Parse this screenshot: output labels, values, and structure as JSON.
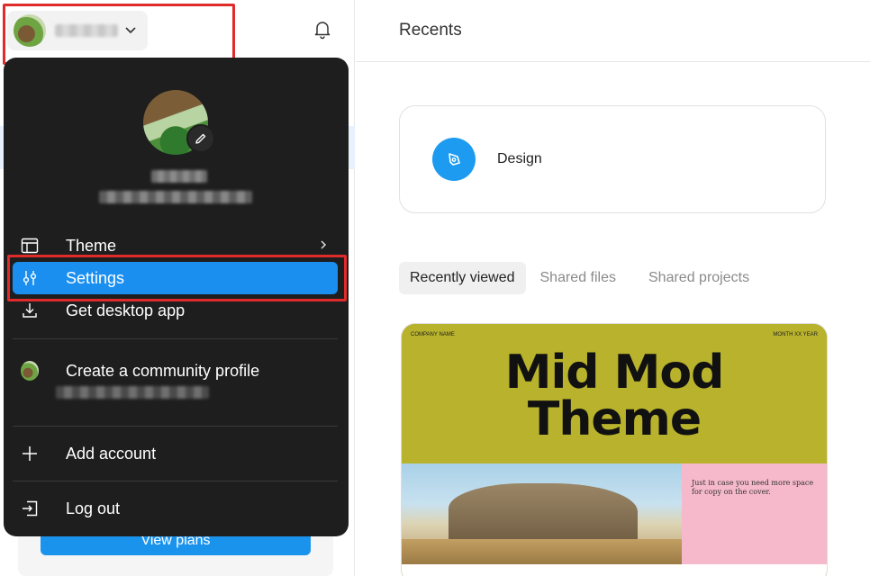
{
  "sidebar": {
    "user_button": {
      "avatar": "user-avatar",
      "chevron": "chevron-down-icon"
    },
    "notifications": {
      "icon": "bell-icon"
    },
    "view_plans_label": "View plans"
  },
  "menu": {
    "items": [
      {
        "label": "Theme",
        "icon": "layout-icon",
        "has_submenu": true
      },
      {
        "label": "Settings",
        "icon": "sliders-icon",
        "selected": true
      },
      {
        "label": "Get desktop app",
        "icon": "download-icon"
      },
      {
        "label": "Create a community profile",
        "icon": "avatar"
      },
      {
        "label": "Add account",
        "icon": "plus-icon"
      },
      {
        "label": "Log out",
        "icon": "logout-icon"
      }
    ]
  },
  "main": {
    "title": "Recents",
    "design_card": {
      "label": "Design",
      "icon": "pen-tool-icon"
    },
    "tabs": [
      {
        "label": "Recently viewed",
        "active": true
      },
      {
        "label": "Shared files",
        "active": false
      },
      {
        "label": "Shared projects",
        "active": false
      }
    ],
    "thumbnail": {
      "company": "COMPANY NAME",
      "date": "MONTH XX YEAR",
      "title_line1": "Mid Mod",
      "title_line2": "Theme",
      "caption": "Just in case you need more space for copy on the cover."
    }
  },
  "colors": {
    "accent": "#1a8ff0",
    "highlight": "#e02b2b",
    "menu_bg": "#1e1e1e",
    "thumb_olive": "#b8b22c",
    "thumb_pink": "#f6b9cc"
  }
}
